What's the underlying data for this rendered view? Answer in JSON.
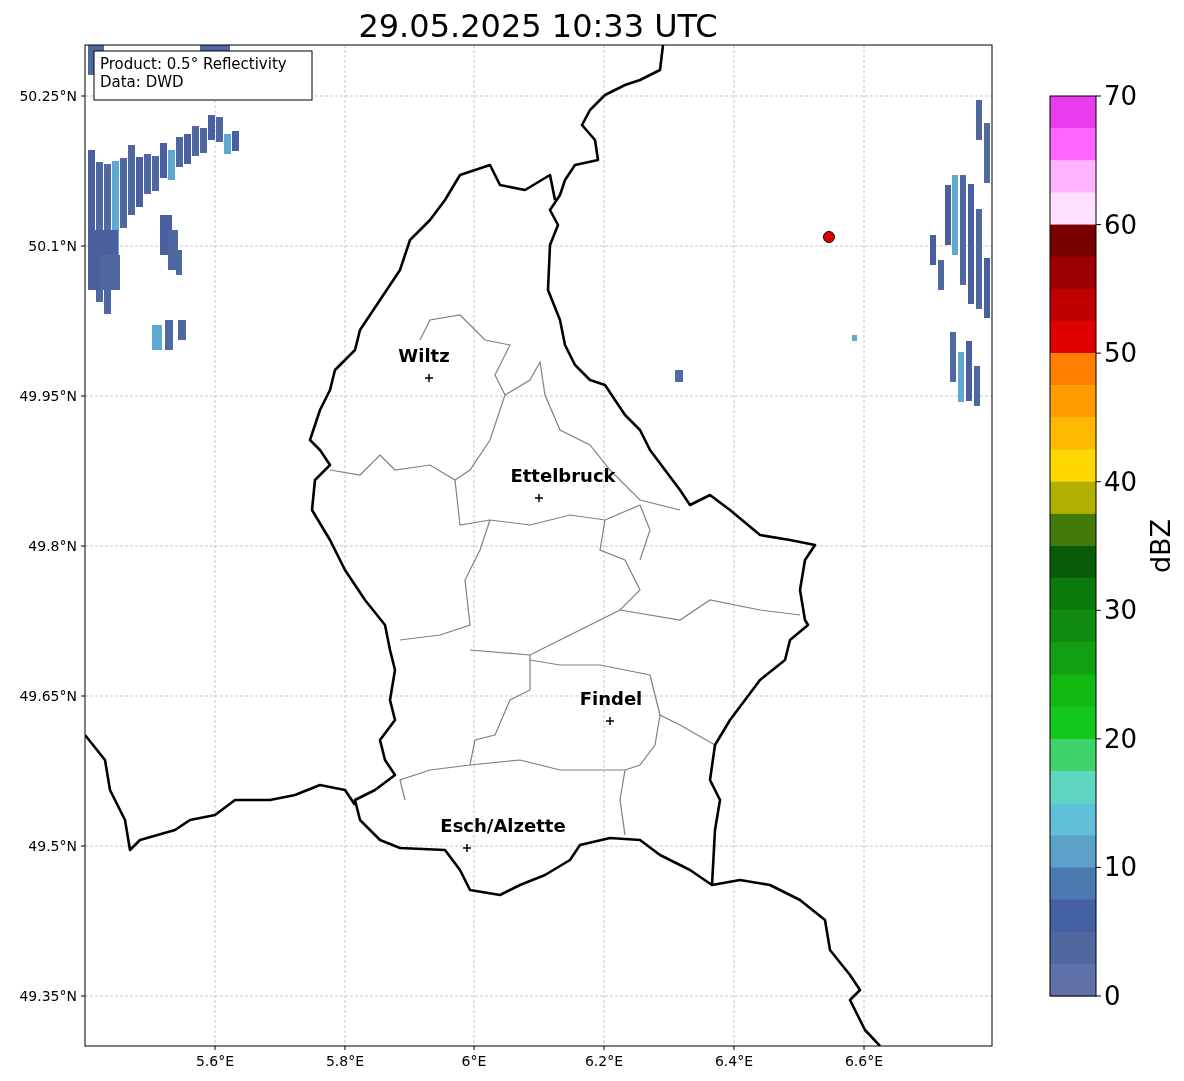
{
  "title": "29.05.2025 10:33 UTC",
  "info_box": {
    "lines": [
      "Product: 0.5° Reflectivity",
      "Data: DWD"
    ]
  },
  "x_ticks": [
    "5.6°E",
    "5.8°E",
    "6°E",
    "6.2°E",
    "6.4°E",
    "6.6°E"
  ],
  "y_ticks": [
    "50.25°N",
    "50.1°N",
    "49.95°N",
    "49.8°N",
    "49.65°N",
    "49.5°N",
    "49.35°N"
  ],
  "cities": [
    {
      "name": "Wiltz"
    },
    {
      "name": "Ettelbruck"
    },
    {
      "name": "Findel"
    },
    {
      "name": "Esch/Alzette"
    }
  ],
  "colorbar": {
    "label": "dBZ",
    "ticks": [
      "70",
      "60",
      "50",
      "40",
      "30",
      "20",
      "10",
      "0"
    ],
    "segments": [
      {
        "color": "#e93cec"
      },
      {
        "color": "#ff66ff"
      },
      {
        "color": "#ffb3ff"
      },
      {
        "color": "#ffe0ff"
      },
      {
        "color": "#7a0000"
      },
      {
        "color": "#9c0000"
      },
      {
        "color": "#c00000"
      },
      {
        "color": "#e00000"
      },
      {
        "color": "#ff7f00"
      },
      {
        "color": "#ff9d00"
      },
      {
        "color": "#ffb800"
      },
      {
        "color": "#ffd700"
      },
      {
        "color": "#b0b000"
      },
      {
        "color": "#437a0a"
      },
      {
        "color": "#085c08"
      },
      {
        "color": "#0a7a0a"
      },
      {
        "color": "#0f8c0f"
      },
      {
        "color": "#11a011"
      },
      {
        "color": "#12b812"
      },
      {
        "color": "#12c81a"
      },
      {
        "color": "#3fd46a"
      },
      {
        "color": "#5fd6c0"
      },
      {
        "color": "#5fc0d8"
      },
      {
        "color": "#5aa0c8"
      },
      {
        "color": "#4a7ab0"
      },
      {
        "color": "#4460a0"
      },
      {
        "color": "#5068a0"
      },
      {
        "color": "#6070a8"
      }
    ]
  }
}
